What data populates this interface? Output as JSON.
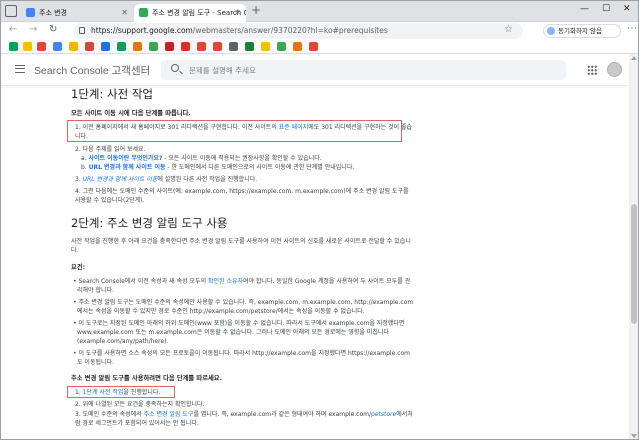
{
  "browser": {
    "tabs": [
      {
        "title": "주소 변경",
        "active": false
      },
      {
        "title": "주소 변경 알림 도구 - Search Co",
        "active": true
      }
    ],
    "url_host": "https://support.google.com",
    "url_path": "/webmasters/answer/9370220?hl=ko#prerequisites",
    "sync_button": "동기화하지 않음",
    "colors": {
      "tabbar": "#dfe1e5",
      "link": "#1a73e8",
      "highlight_box": "#e06666"
    }
  },
  "appbar": {
    "title": "Search Console 고객센터",
    "search_placeholder": "문제를 설명해 주세요"
  },
  "step1": {
    "heading": "1단계: 사전 작업",
    "intro": "모든 사이트 이동 시에 다음 단계를 따릅니다.",
    "item1_a": "1. 이전 홈페이지에서 새 홈페이지로 301 리디렉션을 구현합니다. 이전 사이트의 ",
    "item1_link": "표준 페이지",
    "item1_b": "에도 301 리디렉션을 구현하는 것이 좋습니다.",
    "item2": "2. 다음 주제를 읽어 보세요.",
    "sub_a_link": "사이트 이동이란 무엇인가요?",
    "sub_a_rest": " - 모든 사이트 이동에 적용되는 권장사항을 확인할 수 있습니다.",
    "sub_b_link": "URL 변경과 함께 사이트 이동",
    "sub_b_rest": " - 한 도메인에서 다른 도메인으로의 사이트 이동에 관한 단계별 안내입니다.",
    "item3_link": "URL 변경과 함께 사이트 이동",
    "item3_rest": "에 설명된 다른 사전 작업을 진행합니다.",
    "item4": "4. 그런 다음에는 도메인 수준의 사이트(예: example.com, https://example.com, m.example.com)에 주소 변경 알림 도구를 사용할 수 있습니다(2단계)."
  },
  "step2": {
    "heading": "2단계: 주소 변경 알림 도구 사용",
    "intro": "사전 작업을 진행한 후 아래 요건을 충족한다면 주소 변경 알림 도구를 사용하여 이전 사이트의 신호를 새로운 사이트로 전달할 수 있습니다.",
    "req_label": "요건:",
    "bullets": [
      {
        "a": "Search Console에서 이전 속성과 새 속성 모두의 ",
        "link": "확인된 소유자",
        "b": "여야 합니다. 동일한 Google 계정을 사용하여 두 사이트 모두를 관리해야 합니다."
      },
      {
        "a": "주소 변경 알림 도구는 도메인 수준의 속성에만 사용할 수 있습니다. 즉, example.com, m.example.com, http://example.com에서는 속성을 이동할 수 있지만 경로 수준인 http://example.com/petstore/에서는 속성을 이동할 수 없습니다.",
        "link": "",
        "b": ""
      },
      {
        "a": "이 도구로는 지정된 도메인 아래의 하위 도메인(www 포함)을 이동할 수 없습니다. 따라서 도구에서 example.com을 지정했다면 www.example.com 또는 m.example.com은 이동할 수 없습니다. 그러나 도메인 아래의 모든 경로에는 영향을 미칩니다(example.com/any/path/here).",
        "link": "",
        "b": ""
      },
      {
        "a": "이 도구를 사용하면 소스 속성의 모든 프로토콜이 이동됩니다. 따라서 http://example.com을 지정했다면 https://example.com도 이동됩니다.",
        "link": "",
        "b": ""
      }
    ],
    "use_label": "주소 변경 알림 도구를 사용하려면 다음 단계를 따르세요.",
    "use1_a": "1. ",
    "use1_link": "1단계 사전 작업",
    "use1_b": "을 진행합니다.",
    "use2": "2. 위에 나열된 모든 요건을 충족하는지 확인합니다.",
    "use3_a": "3. 도메인 수준의 속성에서 ",
    "use3_link": "주소 변경 알림 도구",
    "use3_b": "를 엽니다. 즉, example.com과 같은 형태여야 하며 example.com/",
    "use3_i": "petstore",
    "use3_c": "에서처럼 경로 세그먼트가 포함되어 있어서는 안 됩니다."
  }
}
